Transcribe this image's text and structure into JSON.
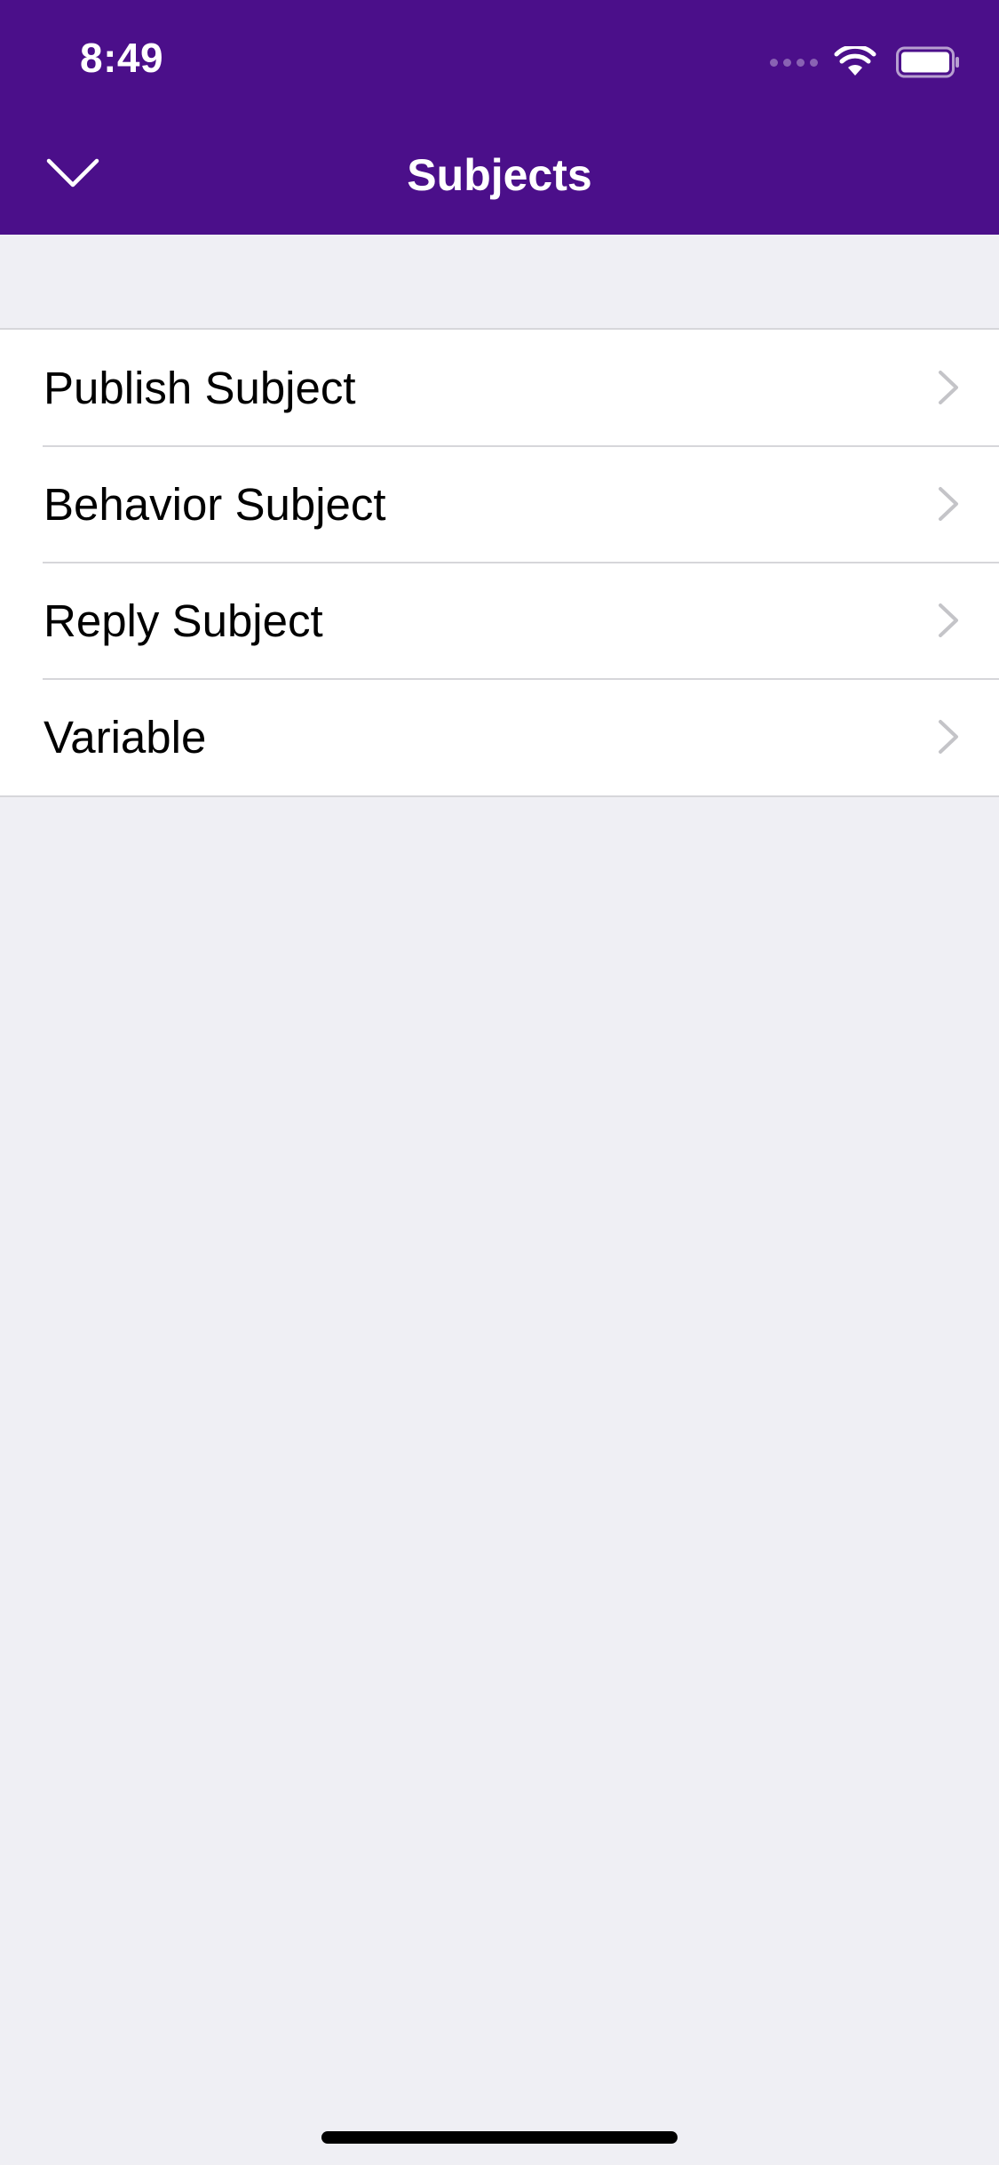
{
  "status_bar": {
    "time": "8:49",
    "icons": [
      "signal-icon",
      "wifi-icon",
      "battery-icon"
    ]
  },
  "nav_bar": {
    "title": "Subjects",
    "left_button_icon": "chevron-down-icon"
  },
  "menu": {
    "items": [
      {
        "label": "Publish Subject",
        "icon": "chevron-right-icon"
      },
      {
        "label": "Behavior Subject",
        "icon": "chevron-right-icon"
      },
      {
        "label": "Reply Subject",
        "icon": "chevron-right-icon"
      },
      {
        "label": "Variable",
        "icon": "chevron-right-icon"
      }
    ]
  },
  "colors": {
    "header": "#4b0f8a",
    "background": "#efeff4",
    "row": "#ffffff",
    "separator": "#d6d6da",
    "chevron": "#c4c4c8"
  }
}
